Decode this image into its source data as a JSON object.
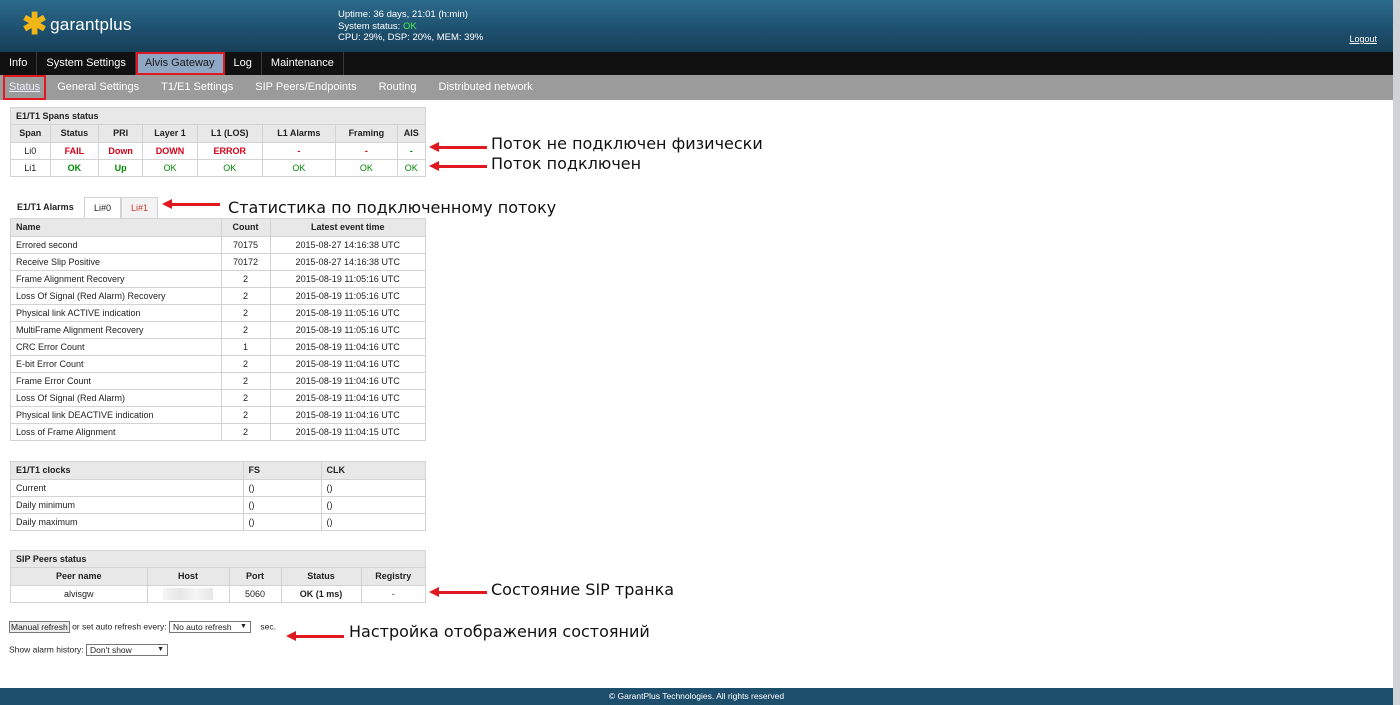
{
  "header": {
    "brand": "garantplus",
    "uptime": "Uptime: 36 days, 21:01 (h:min)",
    "status_label": "System status: ",
    "status_value": "OK",
    "cpu": "CPU: 29%, DSP: 20%, MEM: 39%",
    "logout": "Logout"
  },
  "colors": {
    "header_bg": "#1d4f6d",
    "logo_star": "#f2b516",
    "status_ok": "#4cf04c",
    "highlight": "#e0181f"
  },
  "main_nav": [
    "Info",
    "System Settings",
    "Alvis Gateway",
    "Log",
    "Maintenance"
  ],
  "sub_nav": [
    "Status",
    "General Settings",
    "T1/E1 Settings",
    "SIP Peers/Endpoints",
    "Routing",
    "Distributed network"
  ],
  "spans": {
    "title": "E1/T1 Spans status",
    "columns": [
      "Span",
      "Status",
      "PRI",
      "Layer 1",
      "L1 (LOS)",
      "L1 Alarms",
      "Framing",
      "AIS"
    ],
    "rows": [
      [
        "Li0",
        "FAIL",
        "Down",
        "DOWN",
        "ERROR",
        "-",
        "-",
        "-"
      ],
      [
        "Li1",
        "OK",
        "Up",
        "OK",
        "OK",
        "OK",
        "OK",
        "OK"
      ]
    ]
  },
  "alarms": {
    "label": "E1/T1 Alarms",
    "tabs": [
      "Li#0",
      "Li#1"
    ],
    "columns": [
      "Name",
      "Count",
      "Latest event time"
    ],
    "rows": [
      [
        "Errored second",
        "70175",
        "2015-08-27 14:16:38 UTC"
      ],
      [
        "Receive Slip Positive",
        "70172",
        "2015-08-27 14:16:38 UTC"
      ],
      [
        "Frame Alignment Recovery",
        "2",
        "2015-08-19 11:05:16 UTC"
      ],
      [
        "Loss Of Signal (Red Alarm) Recovery",
        "2",
        "2015-08-19 11:05:16 UTC"
      ],
      [
        "Physical link ACTIVE indication",
        "2",
        "2015-08-19 11:05:16 UTC"
      ],
      [
        "MultiFrame Alignment Recovery",
        "2",
        "2015-08-19 11:05:16 UTC"
      ],
      [
        "CRC Error Count",
        "1",
        "2015-08-19 11:04:16 UTC"
      ],
      [
        "E-bit Error Count",
        "2",
        "2015-08-19 11:04:16 UTC"
      ],
      [
        "Frame Error Count",
        "2",
        "2015-08-19 11:04:16 UTC"
      ],
      [
        "Loss Of Signal (Red Alarm)",
        "2",
        "2015-08-19 11:04:16 UTC"
      ],
      [
        "Physical link DEACTIVE indication",
        "2",
        "2015-08-19 11:04:16 UTC"
      ],
      [
        "Loss of Frame Alignment",
        "2",
        "2015-08-19 11:04:15 UTC"
      ]
    ]
  },
  "clocks": {
    "columns": [
      "E1/T1 clocks",
      "FS",
      "CLK"
    ],
    "rows": [
      [
        "Current",
        "()",
        "()"
      ],
      [
        "Daily minimum",
        "()",
        "()"
      ],
      [
        "Daily maximum",
        "()",
        "()"
      ]
    ]
  },
  "sip": {
    "title": "SIP Peers status",
    "columns": [
      "Peer name",
      "Host",
      "Port",
      "Status",
      "Registry"
    ],
    "row": [
      "alvisgw",
      "",
      "5060",
      "OK (1 ms)",
      "-"
    ]
  },
  "controls": {
    "refresh_button": "Manual refresh",
    "refresh_text": "or set auto refresh every:",
    "refresh_select": "No auto refresh",
    "sec": "sec.",
    "history_label": "Show alarm history:",
    "history_select": "Don't show"
  },
  "annotations": {
    "not_connected": "Поток не подключен физически",
    "connected": "Поток подключен",
    "stats": "Статистика по подключенному потоку",
    "sip_state": "Состояние SIP транка",
    "display_settings": "Настройка отображения состояний"
  },
  "footer": "© GarantPlus Technologies. All rights reserved"
}
